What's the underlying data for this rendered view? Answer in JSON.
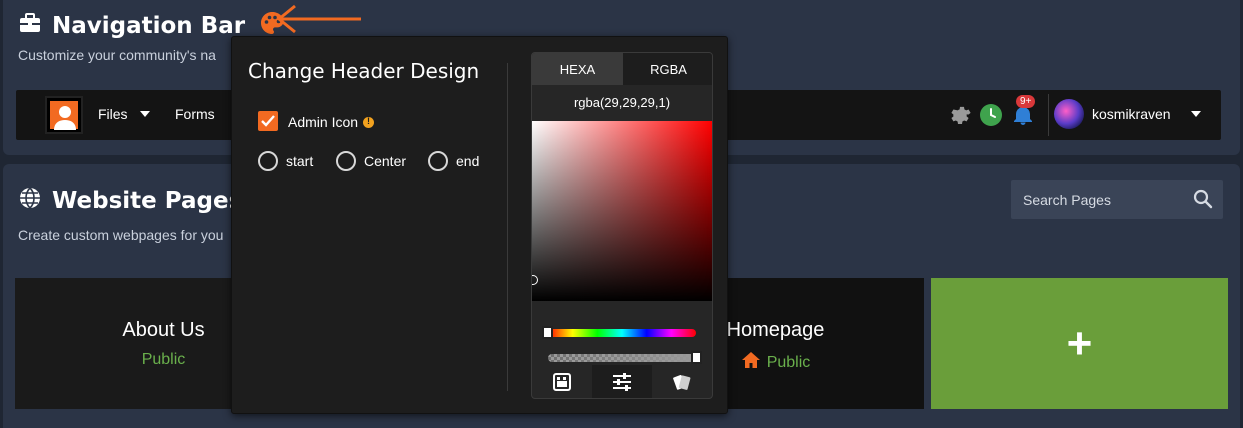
{
  "nav_section": {
    "title": "Navigation Bar",
    "subtitle": "Customize your community's na",
    "palette_icon": "palette-icon",
    "nav": {
      "items": [
        {
          "label": "Files",
          "has_caret": true
        },
        {
          "label": "Forms",
          "has_caret": false
        }
      ],
      "notification_count": "9+",
      "username": "kosmikraven"
    }
  },
  "pages_section": {
    "title": "Website Pages",
    "subtitle": "Create custom webpages for you",
    "search": {
      "placeholder": "Search Pages"
    },
    "cards": [
      {
        "title": "About Us",
        "status": "Public",
        "home": false
      },
      {
        "title": "Homepage",
        "status": "Public",
        "home": true
      }
    ],
    "add_label": "+"
  },
  "popover": {
    "title": "Change Header Design",
    "admin_icon_label": "Admin Icon",
    "admin_icon_checked": true,
    "alignment_options": [
      "start",
      "Center",
      "end"
    ],
    "picker": {
      "tabs": [
        "HEXA",
        "RGBA"
      ],
      "active_tab": "RGBA",
      "value": "rgba(29,29,29,1)"
    }
  },
  "colors": {
    "accent": "#f26a21",
    "add_card": "#6a9e3a",
    "status_public": "#6ab04c",
    "panel_bg": "#2b3446",
    "page_bg": "#1f2633"
  }
}
